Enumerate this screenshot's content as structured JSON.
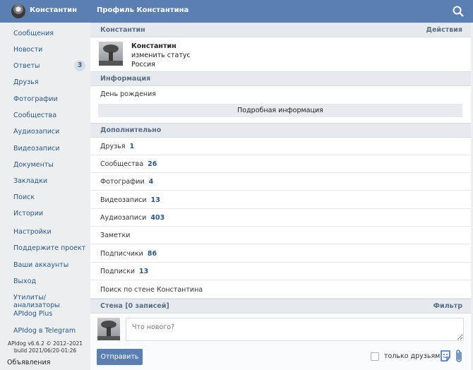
{
  "topbar": {
    "user_name": "Константин",
    "page_title": "Профиль Константина"
  },
  "sidebar": {
    "items": [
      {
        "label": "Сообщения"
      },
      {
        "label": "Новости"
      },
      {
        "label": "Ответы",
        "badge": "3"
      },
      {
        "label": "Друзья"
      },
      {
        "label": "Фотографии"
      },
      {
        "label": "Сообщества"
      },
      {
        "label": "Аудиозаписи"
      },
      {
        "label": "Видеозаписи"
      },
      {
        "label": "Документы"
      },
      {
        "label": "Закладки"
      },
      {
        "label": "Поиск"
      },
      {
        "label": "Истории"
      },
      {
        "label": "Настройки"
      },
      {
        "label": "Поддержите проект"
      },
      {
        "label": "Ваши аккаунты"
      },
      {
        "label": "Выход"
      },
      {
        "label": "Утилиты/анализаторы"
      },
      {
        "label": "APIdog Plus"
      },
      {
        "label": "APIdog в Telegram"
      }
    ],
    "version_line1": "APIdog v6.6.2 © 2012–2021",
    "version_line2": "build 2021/06/20-01:26",
    "footer_item": "Объявления"
  },
  "profile": {
    "header_title": "Константин",
    "header_action": "Действия",
    "name": "Константин",
    "status": "изменить статус",
    "country": "Россия"
  },
  "info": {
    "header": "Информация",
    "birthday_label": "День рождения",
    "more_button": "Подробная информация"
  },
  "extra": {
    "header": "Дополнительно",
    "rows": [
      {
        "label": "Друзья",
        "value": "1"
      },
      {
        "label": "Сообщества",
        "value": "26"
      },
      {
        "label": "Фотографии",
        "value": "4"
      },
      {
        "label": "Видеозаписи",
        "value": "13"
      },
      {
        "label": "Аудиозаписи",
        "value": "403"
      },
      {
        "label": "Заметки",
        "value": ""
      },
      {
        "label": "Подписчики",
        "value": "86"
      },
      {
        "label": "Подписки",
        "value": "13"
      },
      {
        "label": "Поиск по стене Константина",
        "value": ""
      }
    ]
  },
  "wall": {
    "header": "Стена [0 записей]",
    "filter": "Фильтр",
    "placeholder": "Что нового?",
    "send_button": "Отправить",
    "friends_only": "только друзьям"
  },
  "colors": {
    "brand": "#5b7fb3",
    "link": "#2a5885"
  },
  "icons": [
    "search-icon",
    "sticker-icon",
    "attach-icon"
  ]
}
